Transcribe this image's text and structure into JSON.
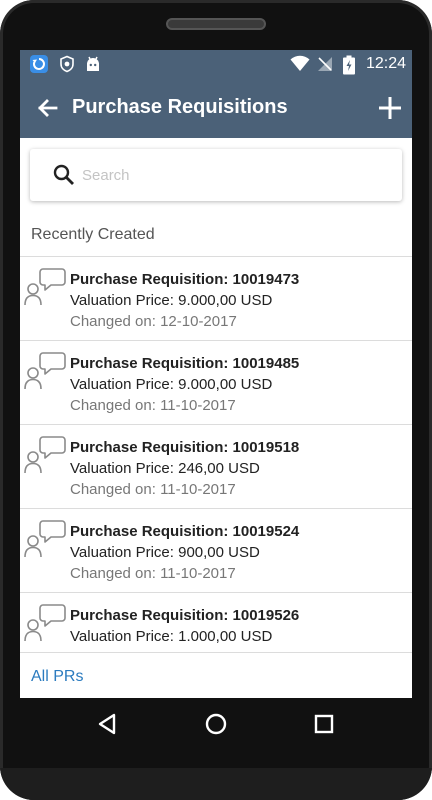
{
  "status_bar": {
    "time": "12:24",
    "icons": [
      "sync-app-icon",
      "shield-app-icon",
      "android-app-icon",
      "wifi-icon",
      "no-signal-icon",
      "battery-charging-icon"
    ]
  },
  "app_bar": {
    "title": "Purchase Requisitions",
    "back_icon": "arrow-left-icon",
    "add_icon": "plus-icon"
  },
  "search": {
    "placeholder": "Search",
    "value": ""
  },
  "section": {
    "title": "Recently Created"
  },
  "items": [
    {
      "title": "Purchase Requisition: 10019473",
      "price": "Valuation Price: 9.000,00  USD",
      "changed": "Changed on: 12-10-2017"
    },
    {
      "title": "Purchase Requisition: 10019485",
      "price": "Valuation Price: 9.000,00  USD",
      "changed": "Changed on: 11-10-2017"
    },
    {
      "title": "Purchase Requisition: 10019518",
      "price": "Valuation Price: 246,00  USD",
      "changed": "Changed on: 11-10-2017"
    },
    {
      "title": "Purchase Requisition: 10019524",
      "price": "Valuation Price: 900,00  USD",
      "changed": "Changed on: 11-10-2017"
    },
    {
      "title": "Purchase Requisition: 10019526",
      "price": "Valuation Price: 1.000,00  USD",
      "changed": ""
    }
  ],
  "footer": {
    "link_label": "All PRs"
  },
  "colors": {
    "app_bar": "#4b6178",
    "link": "#2b7bbf"
  }
}
